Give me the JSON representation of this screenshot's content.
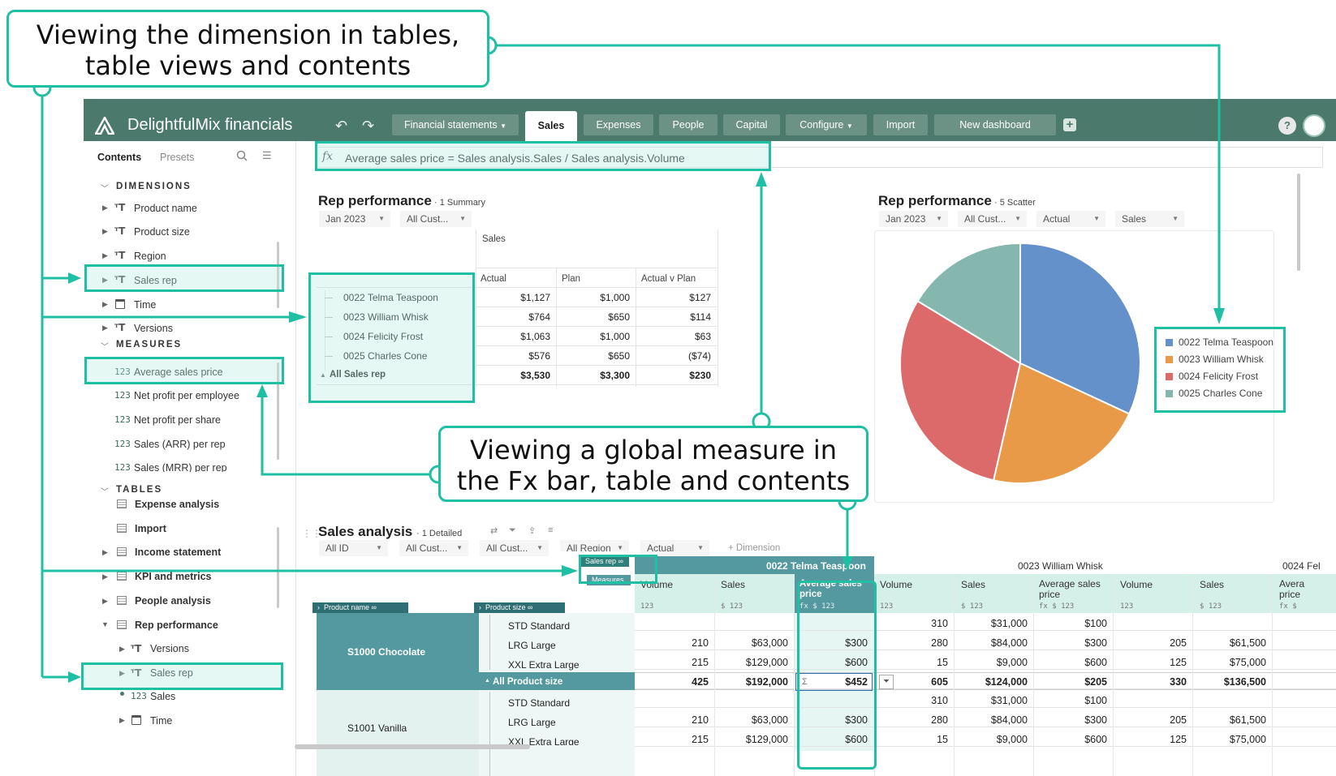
{
  "callouts": {
    "dimension": {
      "line1": "Viewing the dimension in tables,",
      "line2": "table views and contents"
    },
    "measure": {
      "line1": "Viewing a global measure in",
      "line2": "the Fx bar, table and contents"
    }
  },
  "app": {
    "name": "DelightfulMix financials",
    "tabs": [
      "Financial statements",
      "Sales",
      "Expenses",
      "People",
      "Capital",
      "Configure",
      "Import",
      "New dashboard"
    ],
    "active_tab": "Sales",
    "help": "?"
  },
  "left_panel": {
    "tabs": [
      "Contents",
      "Presets"
    ],
    "sections": {
      "dimensions": "DIMENSIONS",
      "measures": "MEASURES",
      "tables": "TABLES"
    },
    "dimensions": [
      "Product name",
      "Product size",
      "Region",
      "Sales rep",
      "Time",
      "Versions"
    ],
    "measures": [
      "Average sales price",
      "Net profit per employee",
      "Net profit per share",
      "Sales (ARR) per rep",
      "Sales (MRR) per rep"
    ],
    "tables": [
      "Expense analysis",
      "Import",
      "Income statement",
      "KPI and metrics",
      "People analysis",
      "Rep performance"
    ],
    "rep_performance_children": [
      "Versions",
      "Sales rep",
      "Sales",
      "Time"
    ]
  },
  "fx": {
    "icon": "fx",
    "formula": "Average sales price = Sales analysis.Sales / Sales analysis.Volume"
  },
  "rep_summary": {
    "title": "Rep performance",
    "subtitle": "1 Summary",
    "filters": [
      "Jan 2023",
      "All Cust..."
    ],
    "group_header": "Sales",
    "columns": [
      "Actual",
      "Plan",
      "Actual v Plan"
    ],
    "rows": [
      {
        "name": "0022 Telma Teaspoon",
        "actual": "$1,127",
        "plan": "$1,000",
        "avp": "$127"
      },
      {
        "name": "0023 William Whisk",
        "actual": "$764",
        "plan": "$650",
        "avp": "$114"
      },
      {
        "name": "0024 Felicity Frost",
        "actual": "$1,063",
        "plan": "$1,000",
        "avp": "$63"
      },
      {
        "name": "0025 Charles Cone",
        "actual": "$576",
        "plan": "$650",
        "avp": "($74)"
      }
    ],
    "total": {
      "name": "All Sales rep",
      "actual": "$3,530",
      "plan": "$3,300",
      "avp": "$230"
    }
  },
  "rep_scatter": {
    "title": "Rep performance",
    "subtitle": "5 Scatter",
    "filters": [
      "Jan 2023",
      "All Cust...",
      "Actual",
      "Sales"
    ]
  },
  "chart_data": {
    "type": "pie",
    "categories": [
      "0022 Telma Teaspoon",
      "0023 William Whisk",
      "0024 Felicity Frost",
      "0025 Charles Cone"
    ],
    "values": [
      1127,
      764,
      1063,
      576
    ],
    "colors": [
      "#6491c9",
      "#e89a48",
      "#dc6a6a",
      "#86b7ae"
    ],
    "legend": "right"
  },
  "sales_analysis": {
    "title": "Sales analysis",
    "subtitle": "1 Detailed",
    "filters": [
      "All ID",
      "All Cust...",
      "All Cust...",
      "All Region",
      "Actual"
    ],
    "add_dimension": "+ Dimension",
    "pills": {
      "sales_rep": "Sales rep",
      "measures": "Measures",
      "product_name": "Product name",
      "product_size": "Product size"
    },
    "reps": [
      "0022 Telma Teaspoon",
      "0023 William Whisk",
      "0024 Fel"
    ],
    "measure_cols": [
      "Volume",
      "Sales",
      "Average sales price",
      "Volume",
      "Sales",
      "Average sales price",
      "Volume",
      "Sales",
      "Avera price"
    ],
    "unit_hints": [
      "123",
      "$ 123",
      "fx $ 123",
      "123",
      "$ 123",
      "fx $ 123",
      "123",
      "$ 123",
      "fx $"
    ],
    "products": [
      "S1000 Chocolate",
      "S1001 Vanilla"
    ],
    "sizes": [
      "STD Standard",
      "LRG Large",
      "XXL Extra Large",
      "All Product size",
      "STD Standard",
      "LRG Large",
      "XXL Extra Large"
    ],
    "rows": [
      [
        "",
        "",
        "",
        "310",
        "$31,000",
        "$100",
        "",
        ""
      ],
      [
        "210",
        "$63,000",
        "$300",
        "280",
        "$84,000",
        "$300",
        "205",
        "$61,500"
      ],
      [
        "215",
        "$129,000",
        "$600",
        "15",
        "$9,000",
        "$600",
        "125",
        "$75,000"
      ],
      [
        "425",
        "$192,000",
        "$452",
        "605",
        "$124,000",
        "$205",
        "330",
        "$136,500"
      ],
      [
        "",
        "",
        "",
        "310",
        "$31,000",
        "$100",
        "",
        ""
      ],
      [
        "210",
        "$63,000",
        "$300",
        "280",
        "$84,000",
        "$300",
        "205",
        "$61,500"
      ],
      [
        "215",
        "$129,000",
        "$600",
        "15",
        "$9,000",
        "$600",
        "125",
        "$75,000"
      ]
    ],
    "sigma": "Σ"
  }
}
